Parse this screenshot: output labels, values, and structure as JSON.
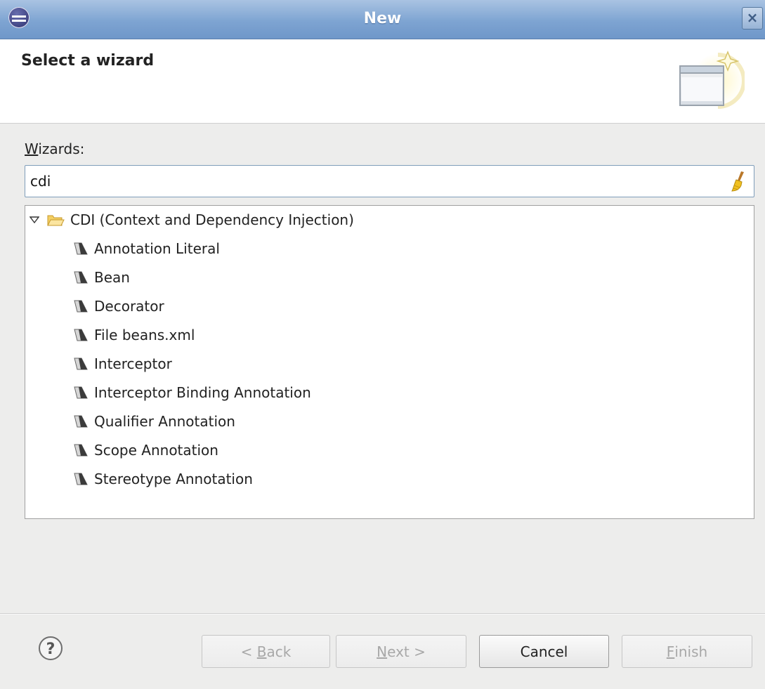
{
  "window": {
    "title": "New",
    "close_symbol": "×",
    "icon": "eclipse-icon"
  },
  "header": {
    "title": "Select a wizard",
    "banner_icon": "new-wizard-banner-icon"
  },
  "wizards": {
    "label_mnemonic": "W",
    "label_rest": "izards:",
    "filter_value": "cdi"
  },
  "tree": {
    "category": "CDI (Context and Dependency Injection)",
    "items": [
      "Annotation Literal",
      "Bean",
      "Decorator",
      "File beans.xml",
      "Interceptor",
      "Interceptor Binding Annotation",
      "Qualifier Annotation",
      "Scope Annotation",
      "Stereotype Annotation"
    ]
  },
  "buttons": {
    "back": {
      "prefix": "< ",
      "mnemonic": "B",
      "rest": "ack",
      "enabled": false
    },
    "next": {
      "mnemonic": "N",
      "rest": "ext >",
      "enabled": false
    },
    "cancel": {
      "label": "Cancel",
      "enabled": true
    },
    "finish": {
      "mnemonic": "F",
      "rest": "inish",
      "enabled": false
    }
  },
  "colors": {
    "titlebar": "#7ea4d2",
    "disabled_text": "#a8a8a8"
  }
}
